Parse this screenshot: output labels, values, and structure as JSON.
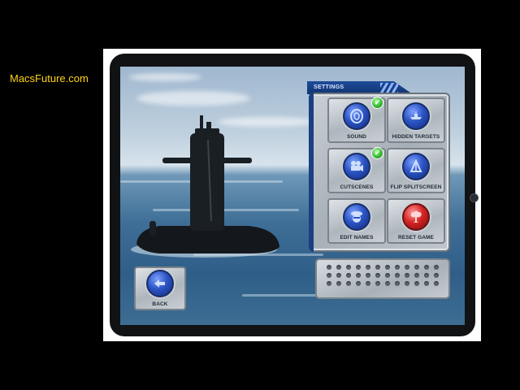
{
  "watermark": "MacsFuture.com",
  "settings": {
    "title": "SETTINGS",
    "tiles": [
      {
        "label": "SOUND",
        "icon": "sound-icon",
        "checked": true,
        "color": "blue"
      },
      {
        "label": "HIDDEN TARGETS",
        "icon": "ship-target-icon",
        "checked": false,
        "color": "blue"
      },
      {
        "label": "CUTSCENES",
        "icon": "film-camera-icon",
        "checked": true,
        "color": "blue"
      },
      {
        "label": "FLIP SPLITSCREEN",
        "icon": "flip-screen-icon",
        "checked": false,
        "color": "blue"
      },
      {
        "label": "EDIT NAMES",
        "icon": "sailor-head-icon",
        "checked": false,
        "color": "blue"
      },
      {
        "label": "RESET GAME",
        "icon": "explosion-icon",
        "checked": false,
        "color": "red"
      }
    ]
  },
  "back": {
    "label": "BACK",
    "icon": "back-arrow-icon"
  },
  "colors": {
    "accent_blue": "#2c54c4",
    "reset_red": "#d52424",
    "check_green": "#2fb32a",
    "watermark": "#ffd21a"
  }
}
